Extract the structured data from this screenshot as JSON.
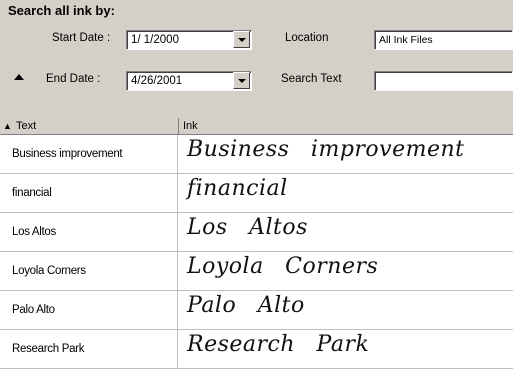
{
  "search_panel": {
    "title": "Search all ink by:",
    "start_date_label": "Start Date :",
    "start_date_value": "1/ 1/2000",
    "end_date_label": "End Date :",
    "end_date_value": "4/26/2001",
    "location_label": "Location",
    "location_value": "All Ink Files",
    "search_text_label": "Search Text",
    "search_text_value": ""
  },
  "grid": {
    "columns": [
      "Text",
      "Ink"
    ],
    "rows": [
      {
        "text": "Business improvement",
        "ink": "Business improvement"
      },
      {
        "text": "financial",
        "ink": "financial"
      },
      {
        "text": "Los Altos",
        "ink": "Los Altos"
      },
      {
        "text": "Loyola Corners",
        "ink": "Loyola Corners"
      },
      {
        "text": "Palo Alto",
        "ink": "Palo Alto"
      },
      {
        "text": "Research Park",
        "ink": "Research Park"
      }
    ]
  }
}
